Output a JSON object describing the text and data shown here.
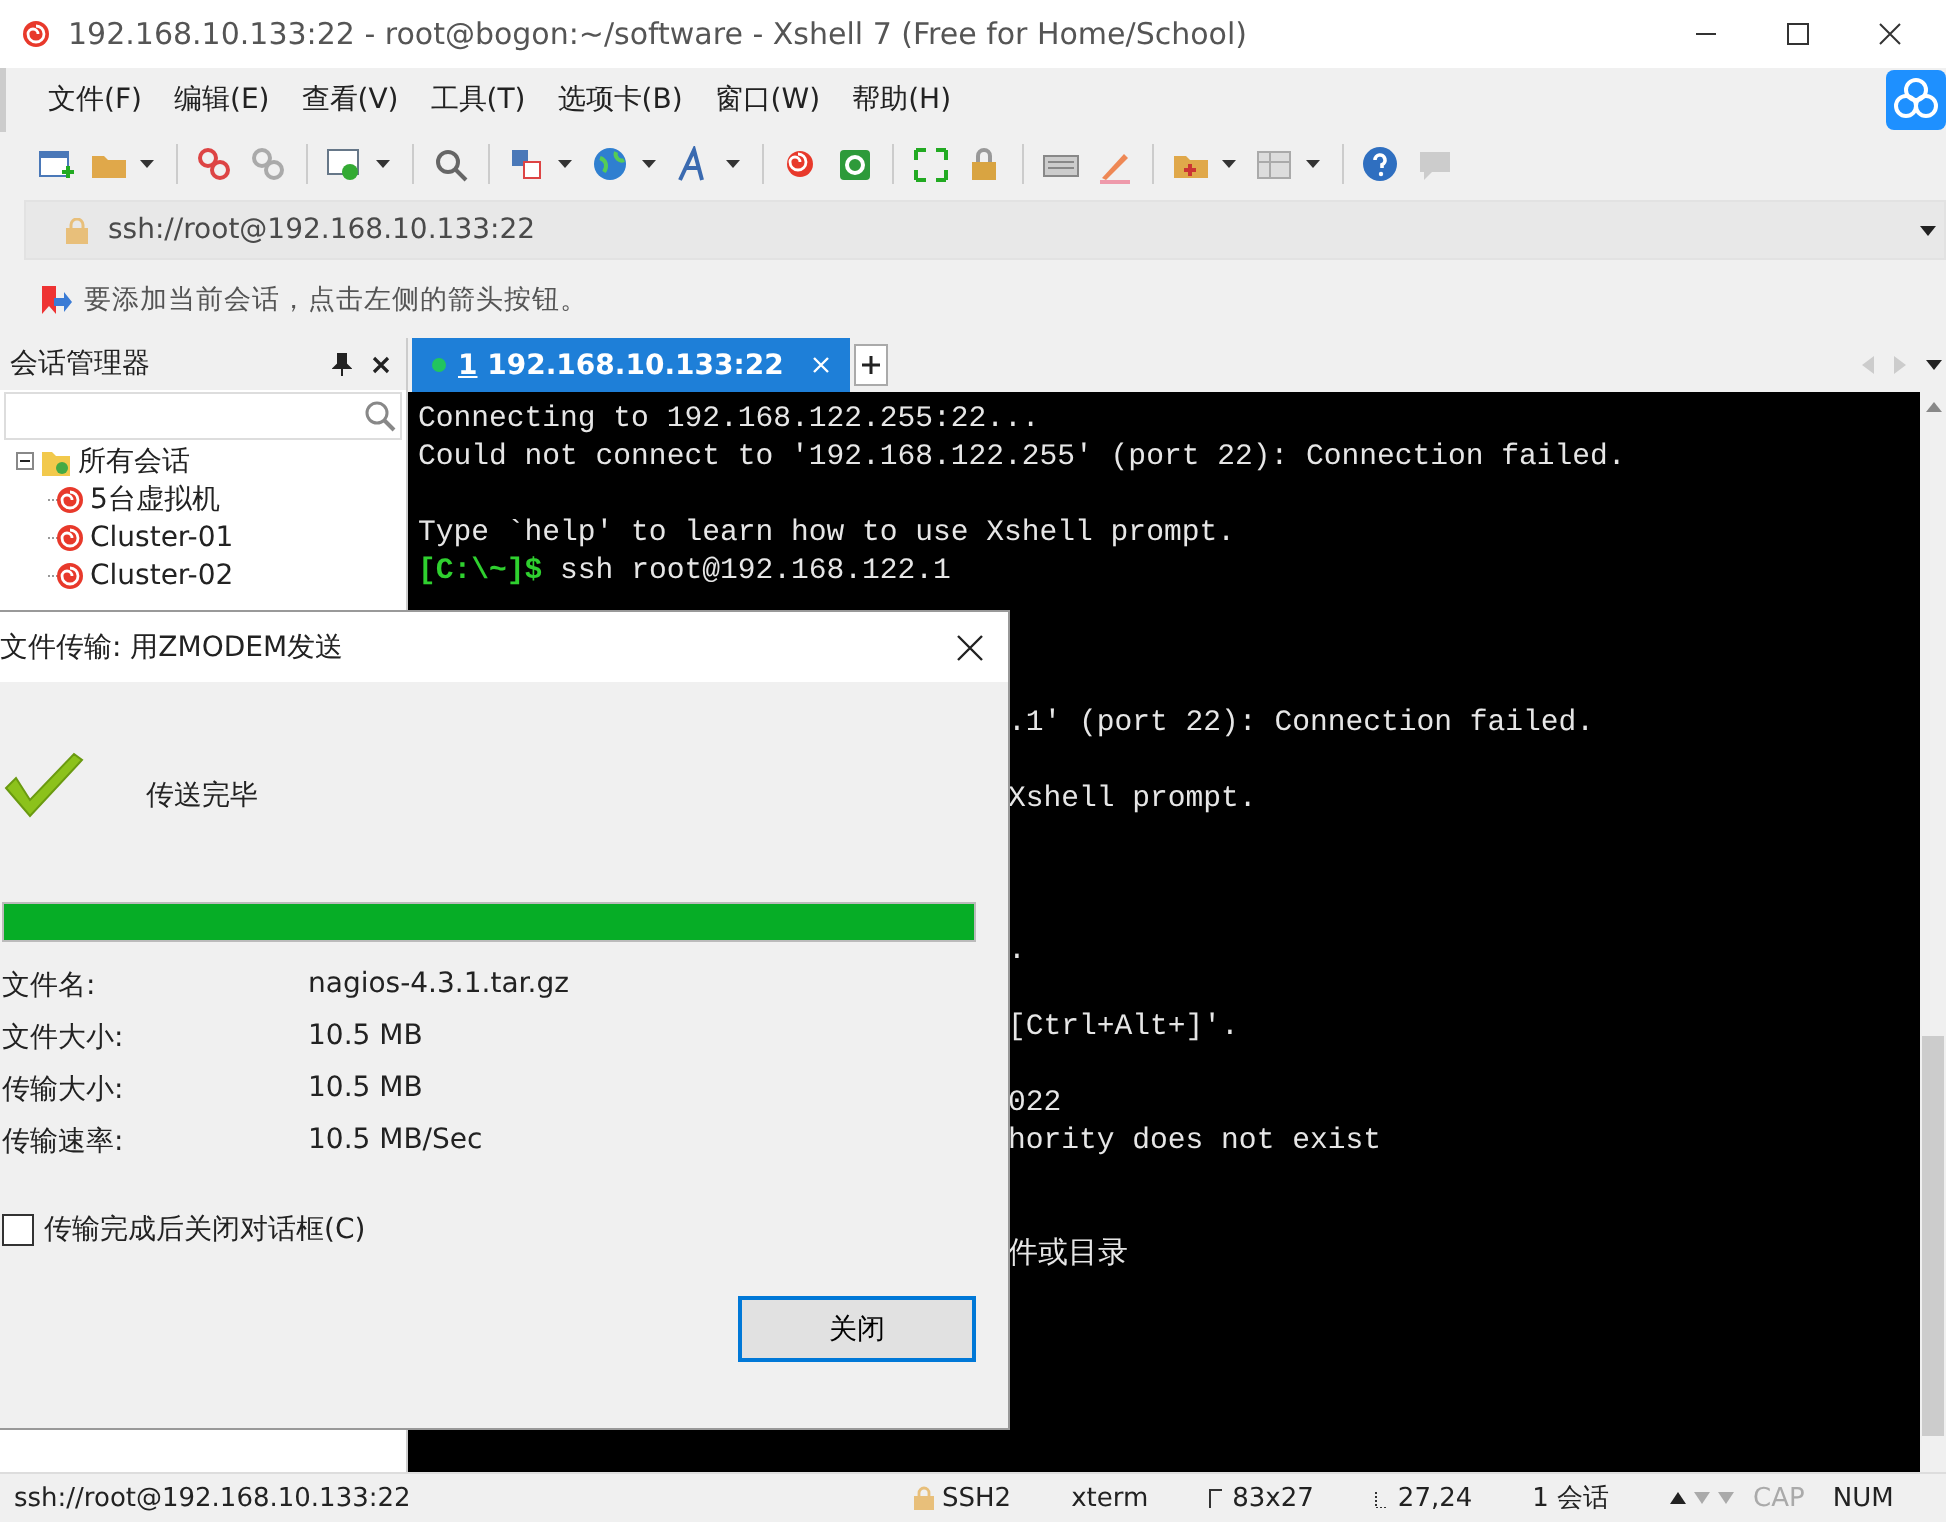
{
  "window": {
    "title": "192.168.10.133:22 - root@bogon:~/software - Xshell 7 (Free for Home/School)"
  },
  "menu": [
    "文件(F)",
    "编辑(E)",
    "查看(V)",
    "工具(T)",
    "选项卡(B)",
    "窗口(W)",
    "帮助(H)"
  ],
  "address_bar": {
    "value": "ssh://root@192.168.10.133:22"
  },
  "hint_bar": {
    "text": "要添加当前会话，点击左侧的箭头按钮。"
  },
  "sidebar": {
    "title": "会话管理器",
    "tree": [
      {
        "label": "所有会话",
        "expanded": true,
        "children": [
          {
            "label": "5台虚拟机"
          },
          {
            "label": "Cluster-01"
          },
          {
            "label": "Cluster-02"
          }
        ]
      }
    ]
  },
  "tabs": [
    {
      "number": "1",
      "label": "192.168.10.133:22",
      "selected": true,
      "connected": true
    }
  ],
  "terminal": {
    "lines": [
      {
        "kind": "output",
        "text": "Connecting to 192.168.122.255:22..."
      },
      {
        "kind": "output",
        "text": "Could not connect to '192.168.122.255' (port 22): Connection failed."
      },
      {
        "kind": "blank"
      },
      {
        "kind": "output",
        "text": "Type `help' to learn how to use Xshell prompt."
      },
      {
        "kind": "prompt",
        "prompt": "[C:\\~]$",
        "text": "ssh root@192.168.122.1"
      },
      {
        "kind": "blank"
      },
      {
        "kind": "blank"
      },
      {
        "kind": "blank"
      },
      {
        "kind": "tail",
        "text": ".1' (port 22): Connection failed."
      },
      {
        "kind": "blank"
      },
      {
        "kind": "tail",
        "text": "Xshell prompt."
      },
      {
        "kind": "blank"
      },
      {
        "kind": "blank"
      },
      {
        "kind": "blank"
      },
      {
        "kind": "tail",
        "text": "."
      },
      {
        "kind": "blank"
      },
      {
        "kind": "tail",
        "text": "[Ctrl+Alt+]'."
      },
      {
        "kind": "blank"
      },
      {
        "kind": "tail",
        "text": "022"
      },
      {
        "kind": "tail",
        "text": "hority does not exist"
      },
      {
        "kind": "blank"
      },
      {
        "kind": "blank"
      },
      {
        "kind": "tail",
        "text": "件或目录"
      }
    ]
  },
  "dialog": {
    "title": "文件传输: 用ZMODEM发送",
    "status": "传送完毕",
    "progress": {
      "level": 1
    },
    "fields": [
      {
        "label": "文件名:",
        "value": "nagios-4.3.1.tar.gz"
      },
      {
        "label": "文件大小:",
        "value": "10.5 MB"
      },
      {
        "label": "传输大小:",
        "value": "10.5 MB"
      },
      {
        "label": "传输速率:",
        "value": "10.5 MB/Sec"
      }
    ],
    "close_when_done": {
      "label": "传输完成后关闭对话框(C)",
      "checked": false
    },
    "button": "关闭"
  },
  "status_bar": {
    "address": "ssh://root@192.168.10.133:22",
    "protocol": "SSH2",
    "terminal_type": "xterm",
    "size": "83x27",
    "cursor": "27,24",
    "sessions": "1 会话",
    "indicators": [
      {
        "label": "CAP",
        "on": false
      },
      {
        "label": "NUM",
        "on": true
      }
    ]
  }
}
